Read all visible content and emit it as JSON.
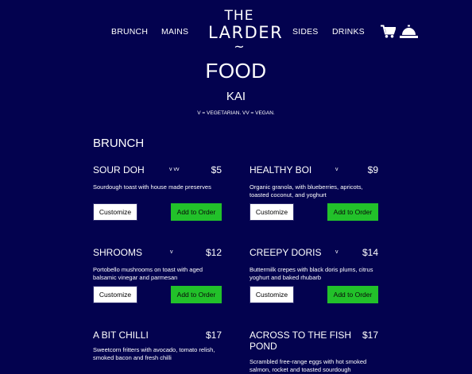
{
  "nav": {
    "left_links": [
      "BRUNCH",
      "MAINS"
    ],
    "right_links": [
      "SIDES",
      "DRINKS"
    ],
    "logo": {
      "line1": "THE",
      "line2": "LARDER",
      "line3": "~"
    },
    "icons": [
      "cart-icon",
      "service-bell-icon"
    ]
  },
  "page": {
    "title": "FOOD",
    "subtitle": "KAI",
    "legend": "V = VEGETARIAN. VV = VEGAN."
  },
  "section": {
    "title": "BRUNCH",
    "customize_label": "Customize",
    "order_label": "Add to Order",
    "items": [
      {
        "name": "SOUR DOH",
        "diet": "v vv",
        "price": "$5",
        "description": "Sourdough toast with house made preserves"
      },
      {
        "name": "HEALTHY BOI",
        "diet": "v",
        "price": "$9",
        "description": "Organic granola, with blueberries, apricots, toasted coconut, and yoghurt"
      },
      {
        "name": "SHROOMS",
        "diet": "v",
        "price": "$12",
        "description": "Portobello mushrooms on toast with aged balsamic vinegar and parmesan"
      },
      {
        "name": "CREEPY DORIS",
        "diet": "v",
        "price": "$14",
        "description": "Buttermilk crepes with black doris plums, citrus yoghurt and baked rhubarb"
      },
      {
        "name": "A BIT CHILLI",
        "diet": "",
        "price": "$17",
        "description": "Sweetcorn fritters with avocado, tomato relish, smoked bacon and fresh chilli"
      },
      {
        "name": "ACROSS TO THE FISH POND",
        "diet": "",
        "price": "$17",
        "description": "Scrambled free-range eggs with hot smoked salmon, rocket and toasted sourdough"
      }
    ]
  },
  "colors": {
    "background": "#03024f",
    "accent_green": "#22c12a",
    "text": "#ffffff"
  }
}
